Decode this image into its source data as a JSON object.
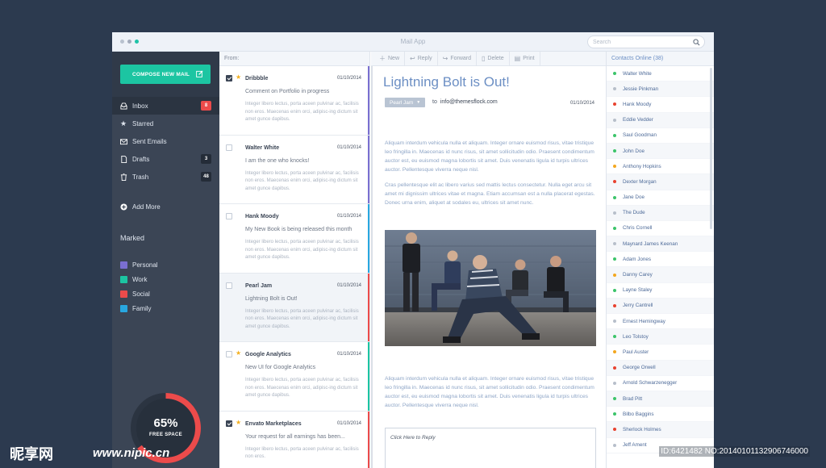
{
  "window": {
    "title": "Mail App"
  },
  "search": {
    "placeholder": "Search"
  },
  "sidebar": {
    "compose_label": "COMPOSE NEW MAIL",
    "items": [
      {
        "label": "Inbox",
        "badge": "8",
        "icon": "inbox-icon"
      },
      {
        "label": "Starred",
        "badge": "",
        "icon": "star-icon"
      },
      {
        "label": "Sent Emails",
        "badge": "",
        "icon": "envelope-icon"
      },
      {
        "label": "Drafts",
        "badge": "3",
        "icon": "draft-icon"
      },
      {
        "label": "Trash",
        "badge": "48",
        "icon": "trash-icon"
      }
    ],
    "add_more": "Add More",
    "marked_title": "Marked",
    "marked": [
      {
        "label": "Personal",
        "color": "#7a6fd0"
      },
      {
        "label": "Work",
        "color": "#1cc5a2"
      },
      {
        "label": "Social",
        "color": "#ec4b4b"
      },
      {
        "label": "Family",
        "color": "#28a7e0"
      }
    ],
    "storage": {
      "percent_label": "65%",
      "label": "FREE SPACE",
      "fraction": 0.65
    }
  },
  "list": {
    "header": "From:",
    "messages": [
      {
        "sender": "Dribbble",
        "date": "01/10/2014",
        "subject": "Comment on Portfolio in progress",
        "preview": "Integer libero lectus, porta aceen pulvinar ac, facilisis non eros. Maecenas enim orci, adipisc-ing dictum sit amet gunce dapibus.",
        "starred": true,
        "checked": true,
        "color": "#7a6fd0"
      },
      {
        "sender": "Walter White",
        "date": "01/10/2014",
        "subject": "I am the one who knocks!",
        "preview": "Integer libero lectus, porta aceen pulvinar ac, facilisis non eros. Maecenas enim orci, adipisc-ing dictum sit amet gunce dapibus.",
        "starred": false,
        "checked": false,
        "color": "#7a6fd0"
      },
      {
        "sender": "Hank Moody",
        "date": "01/10/2014",
        "subject": "My New Book is being released this month",
        "preview": "Integer libero lectus, porta aceen pulvinar ac, facilisis non eros. Maecenas enim orci, adipisc-ing dictum sit amet gunce dapibus.",
        "starred": false,
        "checked": false,
        "color": "#28a7e0"
      },
      {
        "sender": "Pearl Jam",
        "date": "01/10/2014",
        "subject": "Lightning Bolt  is Out!",
        "preview": "Integer libero lectus, porta aceen pulvinar ac, facilisis non eros. Maecenas enim orci, adipisc-ing dictum sit amet gunce dapibus.",
        "starred": false,
        "checked": false,
        "color": "#ec4b4b",
        "selected": true
      },
      {
        "sender": "Google Analytics",
        "date": "01/10/2014",
        "subject": "New UI for Google Analytics",
        "preview": "Integer libero lectus, porta aceen pulvinar ac, facilisis non eros. Maecenas enim orci, adipisc-ing dictum sit amet gunce dapibus.",
        "starred": true,
        "checked": false,
        "color": "#1cc5a2"
      },
      {
        "sender": "Envato Marketplaces",
        "date": "01/10/2014",
        "subject": "Your request for all earnings has been...",
        "preview": "Integer libero lectus, porta aceen pulvinar ac, facilisis non eros.",
        "starred": true,
        "checked": true,
        "color": "#ec4b4b"
      }
    ]
  },
  "toolbar": {
    "new": "New",
    "reply": "Reply",
    "forward": "Forward",
    "delete": "Delete",
    "print": "Print"
  },
  "mail": {
    "title": "Lightning Bolt  is Out!",
    "from": "Pearl Jam",
    "to_label": "to",
    "to_address": "info@themesflock.com",
    "date": "01/10/2014",
    "para1": "Aliquam interdum vehicula nulla et aliquam. Integer ornare euismod risus, vitae tristique leo fringilla in. Maecenas id nunc risus, sit amet sollicitudin odio. Praesent condimentum auctor est, eu euismod magna lobortis sit amet. Duis venenatis ligula id turpis ultrices auctor. Pellentesque viverra neque nisl.",
    "para2": "Cras pellentesque elit ac libero varius sed mattis lectus consectetur. Nulla eget arcu sit amet mi dignissim ultrices vitae et magna. Etiam accumsan est a nulla placerat egestas. Donec urna enim, aliquet at sodales eu, ultrices sit amet nunc.",
    "para3": "Aliquam interdum vehicula nulla et aliquam. Integer ornare euismod risus, vitae tristique leo fringilla in. Maecenas id nunc risus, sit amet sollicitudin odio. Praesent condimentum auctor est, eu euismod magna lobortis sit amet. Duis venenatis ligula id turpis ultrices auctor. Pellentesque viverra neque nisl.",
    "reply_placeholder": "Click Here to Reply"
  },
  "contacts": {
    "header": "Contacts Online (38)",
    "items": [
      {
        "name": "Walter White",
        "status": "#3cc46a"
      },
      {
        "name": "Jessie Pinkman",
        "status": "#b7bfca"
      },
      {
        "name": "Hank Moody",
        "status": "#e8422f"
      },
      {
        "name": "Eddie Vedder",
        "status": "#b7bfca"
      },
      {
        "name": "Saul Goodman",
        "status": "#3cc46a"
      },
      {
        "name": "John Doe",
        "status": "#3cc46a"
      },
      {
        "name": "Anthony Hopkins",
        "status": "#f3a71f"
      },
      {
        "name": "Dexter Morgan",
        "status": "#e8422f"
      },
      {
        "name": "Jane Doe",
        "status": "#3cc46a"
      },
      {
        "name": "The Dude",
        "status": "#b7bfca"
      },
      {
        "name": "Chris Cornell",
        "status": "#3cc46a"
      },
      {
        "name": "Maynard James Keenan",
        "status": "#b7bfca"
      },
      {
        "name": "Adam Jones",
        "status": "#3cc46a"
      },
      {
        "name": "Danny Carey",
        "status": "#f3a71f"
      },
      {
        "name": "Layne Staley",
        "status": "#3cc46a"
      },
      {
        "name": "Jerry Cantrell",
        "status": "#e8422f"
      },
      {
        "name": "Ernest Hemingway",
        "status": "#b7bfca"
      },
      {
        "name": "Leo Tolstoy",
        "status": "#3cc46a"
      },
      {
        "name": "Paul Auster",
        "status": "#f3a71f"
      },
      {
        "name": "George Orwell",
        "status": "#e8422f"
      },
      {
        "name": "Arnold Schwarzenegger",
        "status": "#b7bfca"
      },
      {
        "name": "Brad Pitt",
        "status": "#3cc46a"
      },
      {
        "name": "Bilbo Baggins",
        "status": "#3cc46a"
      },
      {
        "name": "Sherlock Holmes",
        "status": "#e8422f"
      },
      {
        "name": "Jeff Ament",
        "status": "#b7bfca"
      }
    ]
  },
  "watermark": {
    "logo": "昵享网 www.nipic.cn",
    "logo_cn": "昵享网",
    "logo_url": "www.nipic.cn",
    "id_text": "ID:6421482 NO:20140101132906746000"
  }
}
